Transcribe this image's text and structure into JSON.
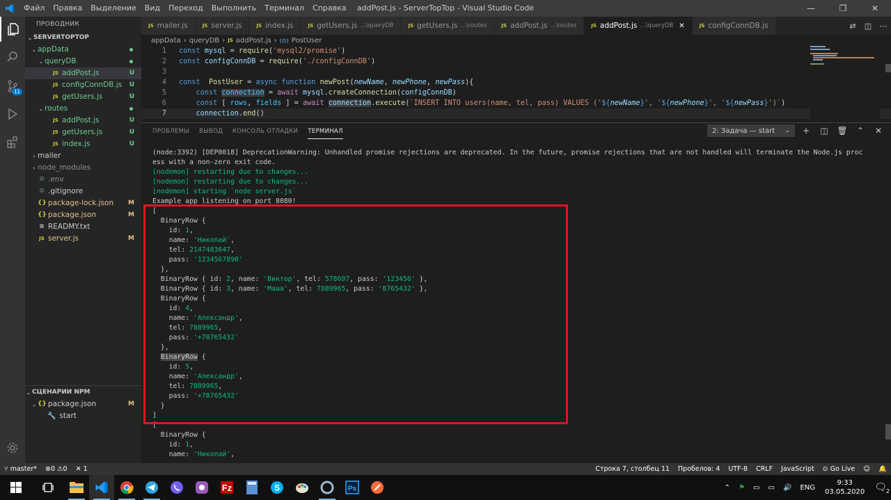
{
  "titlebar": {
    "menu": [
      "Файл",
      "Правка",
      "Выделение",
      "Вид",
      "Переход",
      "Выполнить",
      "Терминал",
      "Справка"
    ],
    "title": "addPost.js - ServerTopTop - Visual Studio Code"
  },
  "sidebar": {
    "header": "ПРОВОДНИК",
    "project": "SERVERTOPTOP",
    "tree": [
      {
        "label": "appData",
        "depth": 0,
        "type": "folder",
        "open": true,
        "color": "green",
        "dot": true
      },
      {
        "label": "queryDB",
        "depth": 1,
        "type": "folder",
        "open": true,
        "color": "green",
        "dot": true
      },
      {
        "label": "addPost.js",
        "depth": 2,
        "type": "js",
        "color": "green",
        "status": "U",
        "selected": true
      },
      {
        "label": "configConnDB.js",
        "depth": 2,
        "type": "js",
        "color": "green",
        "status": "U"
      },
      {
        "label": "getUsers.js",
        "depth": 2,
        "type": "js",
        "color": "green",
        "status": "U"
      },
      {
        "label": "routes",
        "depth": 1,
        "type": "folder",
        "open": true,
        "color": "green",
        "dot": true
      },
      {
        "label": "addPost.js",
        "depth": 2,
        "type": "js",
        "color": "green",
        "status": "U"
      },
      {
        "label": "getUsers.js",
        "depth": 2,
        "type": "js",
        "color": "green",
        "status": "U"
      },
      {
        "label": "index.js",
        "depth": 2,
        "type": "js",
        "color": "green",
        "status": "U"
      },
      {
        "label": "mailer",
        "depth": 0,
        "type": "folder",
        "open": false,
        "color": "plain"
      },
      {
        "label": "node_modules",
        "depth": 0,
        "type": "folder",
        "open": false,
        "color": "gray"
      },
      {
        "label": ".env",
        "depth": 0,
        "type": "gen",
        "color": "gray"
      },
      {
        "label": ".gitignore",
        "depth": 0,
        "type": "gen",
        "color": "plain"
      },
      {
        "label": "package-lock.json",
        "depth": 0,
        "type": "json",
        "color": "amber",
        "status": "M"
      },
      {
        "label": "package.json",
        "depth": 0,
        "type": "json",
        "color": "amber",
        "status": "M"
      },
      {
        "label": "READMY.txt",
        "depth": 0,
        "type": "txt",
        "color": "plain"
      },
      {
        "label": "server.js",
        "depth": 0,
        "type": "js",
        "color": "amber",
        "status": "M"
      }
    ],
    "npm_header": "СЦЕНАРИИ NPM",
    "npm_package": "package.json",
    "npm_package_status": "M",
    "npm_script": "start"
  },
  "tabs": [
    {
      "label": "mailer.js",
      "desc": ""
    },
    {
      "label": "server.js",
      "desc": ""
    },
    {
      "label": "index.js",
      "desc": ""
    },
    {
      "label": "getUsers.js",
      "desc": "...\\queryDB"
    },
    {
      "label": "getUsers.js",
      "desc": "...\\routes"
    },
    {
      "label": "addPost.js",
      "desc": "...\\routes"
    },
    {
      "label": "addPost.js",
      "desc": "...\\queryDB",
      "active": true
    },
    {
      "label": "configConnDB.js",
      "desc": ""
    }
  ],
  "breadcrumb": [
    "appData",
    "queryDB",
    "addPost.js",
    "PostUser"
  ],
  "editor": {
    "current_line": 7,
    "lines": [
      [
        [
          "k",
          "const "
        ],
        [
          "v",
          "mysql"
        ],
        [
          "w",
          " = "
        ],
        [
          "f",
          "require"
        ],
        [
          "w",
          "("
        ],
        [
          "s",
          "'mysql2/promise'"
        ],
        [
          "w",
          ")"
        ]
      ],
      [
        [
          "k",
          "const "
        ],
        [
          "v",
          "configConnDB"
        ],
        [
          "w",
          " = "
        ],
        [
          "f",
          "require"
        ],
        [
          "w",
          "("
        ],
        [
          "s",
          "'./configConnDB'"
        ],
        [
          "w",
          ")"
        ]
      ],
      [],
      [
        [
          "k",
          "const "
        ],
        [
          "w",
          " "
        ],
        [
          "f",
          "PostUser"
        ],
        [
          "w",
          " = "
        ],
        [
          "k",
          "async "
        ],
        [
          "t",
          "function "
        ],
        [
          "f",
          "newPost"
        ],
        [
          "w",
          "("
        ],
        [
          "p",
          "newName"
        ],
        [
          "w",
          ", "
        ],
        [
          "p",
          "newPhone"
        ],
        [
          "w",
          ", "
        ],
        [
          "p",
          "newPass"
        ],
        [
          "w",
          "){"
        ]
      ],
      [
        [
          "w",
          "    "
        ],
        [
          "k",
          "const "
        ],
        [
          "c",
          "connection"
        ],
        [
          "w",
          " = "
        ],
        [
          "kc",
          "await "
        ],
        [
          "v",
          "mysql"
        ],
        [
          "w",
          "."
        ],
        [
          "f",
          "createConnection"
        ],
        [
          "w",
          "("
        ],
        [
          "v",
          "configConnDB"
        ],
        [
          "w",
          ")"
        ]
      ],
      [
        [
          "w",
          "    "
        ],
        [
          "k",
          "const "
        ],
        [
          "w",
          "[ "
        ],
        [
          "c",
          "rows"
        ],
        [
          "w",
          ", "
        ],
        [
          "c",
          "fields"
        ],
        [
          "w",
          " ] = "
        ],
        [
          "kc",
          "await "
        ],
        [
          "v",
          "connection"
        ],
        [
          "w",
          "."
        ],
        [
          "f",
          "execute"
        ],
        [
          "w",
          "("
        ],
        [
          "s",
          "`INSERT INTO users(name, tel, pass) VALUES ('"
        ],
        [
          "k",
          "${"
        ],
        [
          "p",
          "newName"
        ],
        [
          "k",
          "}"
        ],
        [
          "s",
          "', '"
        ],
        [
          "k",
          "${"
        ],
        [
          "p",
          "newPhone"
        ],
        [
          "k",
          "}"
        ],
        [
          "s",
          "', '"
        ],
        [
          "k",
          "${"
        ],
        [
          "p",
          "newPass"
        ],
        [
          "k",
          "}"
        ],
        [
          "s",
          "')`"
        ],
        [
          "w",
          ")"
        ]
      ],
      [
        [
          "w",
          "    "
        ],
        [
          "v",
          "connection"
        ],
        [
          "w",
          "."
        ],
        [
          "f",
          "end"
        ],
        [
          "w",
          "()"
        ]
      ]
    ]
  },
  "panel": {
    "tabs": [
      "ПРОБЛЕМЫ",
      "ВЫВОД",
      "КОНСОЛЬ ОТЛАДКИ",
      "ТЕРМИНАЛ"
    ],
    "active_tab": "ТЕРМИНАЛ",
    "task_select": "2: Задача — start",
    "terminal": [
      [
        [
          "w",
          "(node:3392) [DEP0018] DeprecationWarning: Unhandled promise rejections are deprecated. In the future, promise rejections that are not handled will terminate the Node.js proc"
        ]
      ],
      [
        [
          "w",
          "ess with a non-zero exit code."
        ]
      ],
      [
        [
          "g",
          "[nodemon] restarting due to changes..."
        ]
      ],
      [
        [
          "g",
          "[nodemon] restarting due to changes..."
        ]
      ],
      [
        [
          "g",
          "[nodemon] starting `node server.js`"
        ]
      ],
      [
        [
          "w",
          "Example app listening on port 8080!"
        ]
      ],
      [
        [
          "w",
          "["
        ]
      ],
      [
        [
          "w",
          "  BinaryRow {"
        ]
      ],
      [
        [
          "w",
          "    id: "
        ],
        [
          "n",
          "1"
        ],
        [
          "w",
          ","
        ]
      ],
      [
        [
          "w",
          "    name: "
        ],
        [
          "s",
          "'Николай'"
        ],
        [
          "w",
          ","
        ]
      ],
      [
        [
          "w",
          "    tel: "
        ],
        [
          "n",
          "2147483647"
        ],
        [
          "w",
          ","
        ]
      ],
      [
        [
          "w",
          "    pass: "
        ],
        [
          "s",
          "'1234567890'"
        ]
      ],
      [
        [
          "w",
          "  },"
        ]
      ],
      [
        [
          "w",
          "  BinaryRow { id: "
        ],
        [
          "n",
          "2"
        ],
        [
          "w",
          ", name: "
        ],
        [
          "s",
          "'Виктор'"
        ],
        [
          "w",
          ", tel: "
        ],
        [
          "n",
          "578697"
        ],
        [
          "w",
          ", pass: "
        ],
        [
          "s",
          "'123456'"
        ],
        [
          "w",
          " },"
        ]
      ],
      [
        [
          "w",
          "  BinaryRow { id: "
        ],
        [
          "n",
          "3"
        ],
        [
          "w",
          ", name: "
        ],
        [
          "s",
          "'Маша'"
        ],
        [
          "w",
          ", tel: "
        ],
        [
          "n",
          "7889965"
        ],
        [
          "w",
          ", pass: "
        ],
        [
          "s",
          "'8765432'"
        ],
        [
          "w",
          " },"
        ]
      ],
      [
        [
          "w",
          "  BinaryRow {"
        ]
      ],
      [
        [
          "w",
          "    id: "
        ],
        [
          "n",
          "4"
        ],
        [
          "w",
          ","
        ]
      ],
      [
        [
          "w",
          "    name: "
        ],
        [
          "s",
          "'Александр'"
        ],
        [
          "w",
          ","
        ]
      ],
      [
        [
          "w",
          "    tel: "
        ],
        [
          "n",
          "7889965"
        ],
        [
          "w",
          ","
        ]
      ],
      [
        [
          "w",
          "    pass: "
        ],
        [
          "s",
          "'+78765432'"
        ]
      ],
      [
        [
          "w",
          "  },"
        ]
      ],
      [
        [
          "w",
          "  "
        ],
        [
          "h",
          "BinaryRow"
        ],
        [
          "w",
          " {"
        ]
      ],
      [
        [
          "w",
          "    id: "
        ],
        [
          "n",
          "5"
        ],
        [
          "w",
          ","
        ]
      ],
      [
        [
          "w",
          "    name: "
        ],
        [
          "s",
          "'Александр'"
        ],
        [
          "w",
          ","
        ]
      ],
      [
        [
          "w",
          "    tel: "
        ],
        [
          "n",
          "7889965"
        ],
        [
          "w",
          ","
        ]
      ],
      [
        [
          "w",
          "    pass: "
        ],
        [
          "s",
          "'+78765432'"
        ]
      ],
      [
        [
          "w",
          "  }"
        ]
      ],
      [
        [
          "w",
          "]"
        ]
      ],
      [
        [
          "w",
          "["
        ]
      ],
      [
        [
          "w",
          "  BinaryRow {"
        ]
      ],
      [
        [
          "w",
          "    id: "
        ],
        [
          "n",
          "1"
        ],
        [
          "w",
          ","
        ]
      ],
      [
        [
          "w",
          "    name: "
        ],
        [
          "s",
          "'Николай'"
        ],
        [
          "w",
          ","
        ]
      ]
    ]
  },
  "statusbar": {
    "branch": "master*",
    "problems": "⊗0 ⚠0",
    "tools": "1",
    "position": "Строка 7, столбец 11",
    "spaces": "Пробелов: 4",
    "encoding": "UTF-8",
    "eol": "CRLF",
    "language": "JavaScript",
    "golive": "Go Live"
  },
  "taskbar": {
    "lang": "ENG",
    "time": "9:33",
    "date": "03.05.2020",
    "notif": "2"
  },
  "colors": {
    "accent": "#007acc",
    "highlight_box": "#e0151f"
  }
}
